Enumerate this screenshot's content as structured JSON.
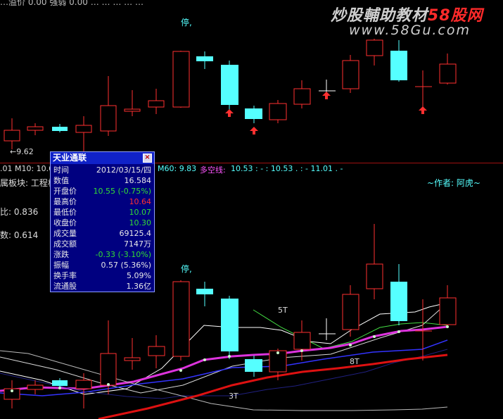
{
  "top_bar": {
    "text": "…溢价 0.00  强弱 0.00  …  …  …  …  …"
  },
  "watermark": {
    "line1_prefix": "炒股輔助教材",
    "line1_brand": "58股网",
    "line2": "www.58Gu.com"
  },
  "main_chart": {
    "stop_label": "停,",
    "price_marker": "←9.62"
  },
  "indicator_bar": {
    "m10_prefix": ".01  M10: 10.6",
    "m60": "M60: 9.83",
    "duokong_label": "多空线:",
    "values": "10.53 : - : 10.53 . : - 11.01 . -"
  },
  "sidebar_labels": {
    "board": "属板块: 工程机",
    "ratio": "比: 0.836",
    "count": "数: 0.614"
  },
  "author": "~作者: 阿虎~",
  "lower_chart": {
    "stop_label": "停,",
    "label_5t": "5T",
    "label_8t": "8T",
    "label_3t": "3T"
  },
  "info_panel": {
    "title": "天业通联",
    "close": "×",
    "rows": [
      {
        "label": "时间",
        "value": "2012/03/15/四",
        "color": "#e8e8e8"
      },
      {
        "label": "数值",
        "value": "16.584",
        "color": "#e8e8e8"
      },
      {
        "label": "开盘价",
        "value": "10.55 (-0.75%)",
        "color": "#33dd33"
      },
      {
        "label": "最高价",
        "value": "10.64",
        "color": "#ff3030"
      },
      {
        "label": "最低价",
        "value": "10.07",
        "color": "#33dd33"
      },
      {
        "label": "收盘价",
        "value": "10.30",
        "color": "#33dd33"
      },
      {
        "label": "成交量",
        "value": "69125.4",
        "color": "#e8e8e8"
      },
      {
        "label": "成交额",
        "value": "7147万",
        "color": "#e8e8e8"
      },
      {
        "label": "涨跌",
        "value": "-0.33 (-3.10%)",
        "color": "#33dd33"
      },
      {
        "label": "振幅",
        "value": "0.57 (5.36%)",
        "color": "#e8e8e8"
      },
      {
        "label": "换手率",
        "value": "5.09%",
        "color": "#e8e8e8"
      },
      {
        "label": "流通股",
        "value": "1.36亿",
        "color": "#e8e8e8"
      }
    ]
  },
  "colors": {
    "up": "#ff3030",
    "down": "#55ffff",
    "ma_white": "#ffffff",
    "ma_magenta": "#dd33dd",
    "ma_blue": "#2222cc",
    "ma_red": "#dd1111"
  }
}
